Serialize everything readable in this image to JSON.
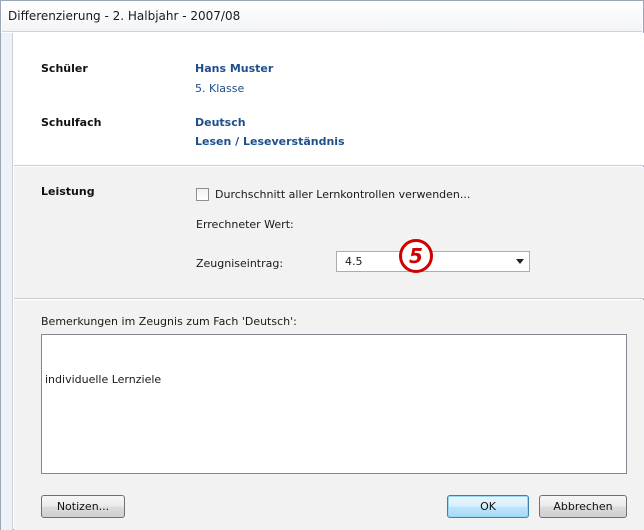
{
  "window": {
    "title": "Differenzierung - 2. Halbjahr - 2007/08"
  },
  "student": {
    "label": "Schüler",
    "name": "Hans Muster",
    "class": "5. Klasse"
  },
  "subject": {
    "label": "Schulfach",
    "name": "Deutsch",
    "area": "Lesen / Leseverständnis"
  },
  "performance": {
    "label": "Leistung",
    "checkbox_label": "Durchschnitt aller Lernkontrollen verwenden...",
    "checkbox_checked": false,
    "computed_label": "Errechneter Wert:",
    "report_label": "Zeugniseintrag:",
    "report_value": "4.5"
  },
  "annotation": {
    "number": "5",
    "color": "#d10000"
  },
  "remarks": {
    "label": "Bemerkungen im Zeugnis zum Fach 'Deutsch':",
    "text": "individuelle Lernziele"
  },
  "buttons": {
    "notes": "Notizen...",
    "ok": "OK",
    "cancel": "Abbrechen"
  },
  "colors": {
    "value_text": "#1f4e8c",
    "default_button_border": "#3c7fb1"
  }
}
